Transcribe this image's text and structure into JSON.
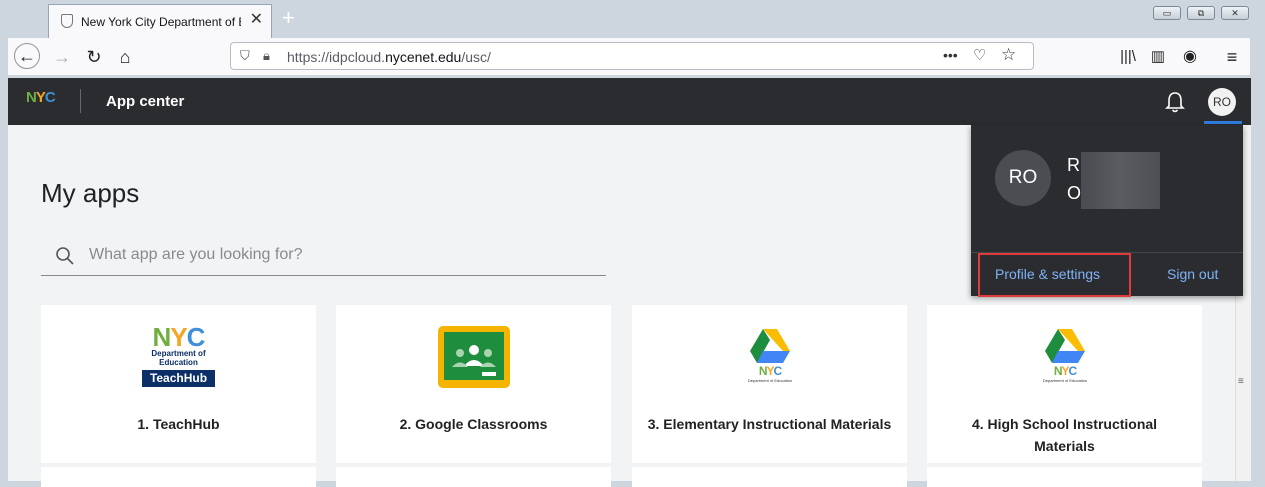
{
  "browser": {
    "tab_title": "New York City Department of Education",
    "new_tab_label": "+",
    "url_prefix": "https://idpcloud.",
    "url_domain": "nycenet.edu",
    "url_path": "/usc/"
  },
  "header": {
    "logo": {
      "n": "N",
      "y": "Y",
      "c": "C"
    },
    "app_title": "App center",
    "avatar_initials": "RO"
  },
  "main": {
    "title": "My apps",
    "search_placeholder": "What app are you looking for?",
    "apps": [
      {
        "name": "1. TeachHub",
        "logo_line1": "Department of",
        "logo_line2": "Education",
        "logo_banner": "TeachHub"
      },
      {
        "name": "2. Google Classrooms"
      },
      {
        "name": "3. Elementary Instructional Materials",
        "logo_caption": "Department of Education"
      },
      {
        "name": "4. High School Instructional Materials",
        "logo_caption": "Department of Education"
      }
    ]
  },
  "dropdown": {
    "initials": "RO",
    "name_line1": "R",
    "name_line2": "O",
    "profile_label": "Profile & settings",
    "signout_label": "Sign out"
  },
  "colors": {
    "header_bg": "#2b2c30",
    "accent_blue": "#2f7fe0",
    "link_blue": "#7fb3f5",
    "highlight_red": "#e03b3b",
    "nyc_green": "#6fae3f",
    "nyc_yellow": "#f5a623",
    "nyc_blue": "#3f8fd6"
  }
}
